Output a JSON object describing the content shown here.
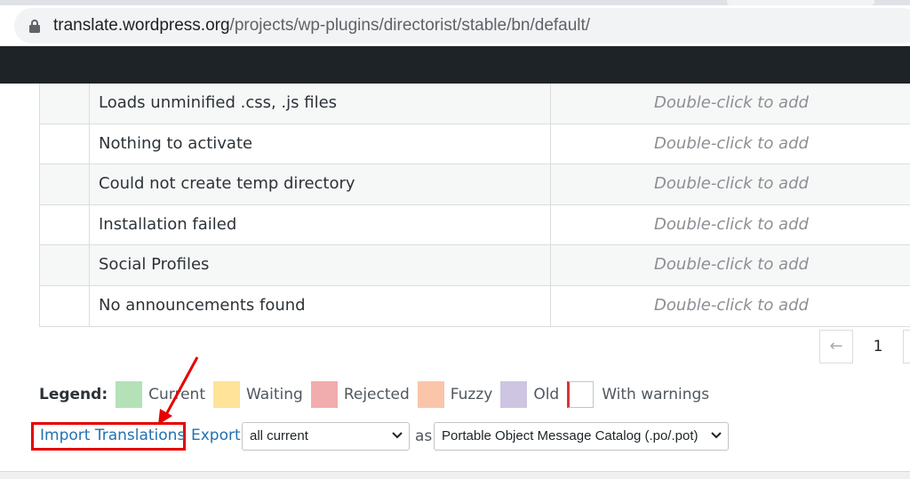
{
  "browser": {
    "url_host": "translate.wordpress.org",
    "url_path": "/projects/wp-plugins/directorist/stable/bn/default/"
  },
  "rows": [
    {
      "original": "Loads unminified .css, .js files",
      "translation": "Double-click to add"
    },
    {
      "original": "Nothing to activate",
      "translation": "Double-click to add"
    },
    {
      "original": "Could not create temp directory",
      "translation": "Double-click to add"
    },
    {
      "original": "Installation failed",
      "translation": "Double-click to add"
    },
    {
      "original": "Social Profiles",
      "translation": "Double-click to add"
    },
    {
      "original": "No announcements found",
      "translation": "Double-click to add"
    }
  ],
  "pagination": {
    "prev": "←",
    "current_page": "1"
  },
  "legend": {
    "title": "Legend:",
    "items": [
      {
        "label": "Current",
        "color": "#b5e1b9"
      },
      {
        "label": "Waiting",
        "color": "#ffe399"
      },
      {
        "label": "Rejected",
        "color": "#f1adad"
      },
      {
        "label": "Fuzzy",
        "color": "#fbc5a9"
      },
      {
        "label": "Old",
        "color": "#cdc5e1"
      },
      {
        "label": "With warnings",
        "color": "#d63638"
      }
    ]
  },
  "actions": {
    "import_label": "Import Translations",
    "export_label": "Export",
    "filter_value": "all current",
    "as_label": "as",
    "format_value": "Portable Object Message Catalog (.po/.pot)"
  },
  "colors": {
    "link": "#2271b1",
    "highlight": "#e60000",
    "adminbar": "#1e2327"
  }
}
